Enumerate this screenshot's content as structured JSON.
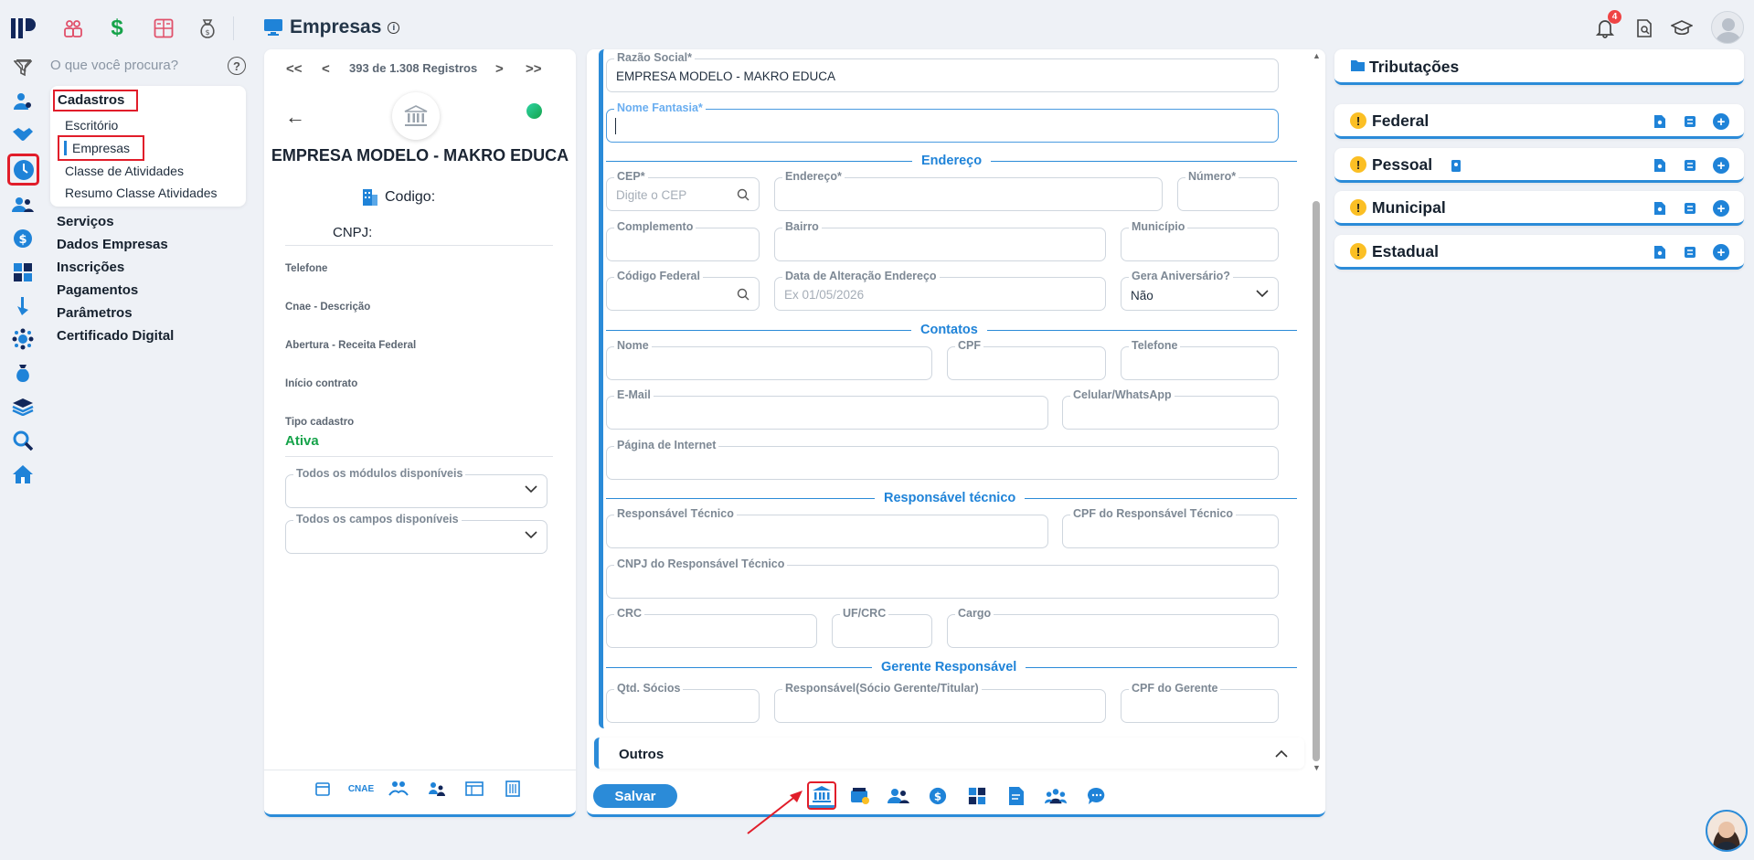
{
  "app": {
    "title": "Empresas"
  },
  "topbar": {
    "notification_count": "4"
  },
  "search": {
    "placeholder": "O que você procura?"
  },
  "submenu": {
    "heading": "Cadastros",
    "items": [
      "Escritório",
      "Empresas",
      "Classe de Atividades",
      "Resumo Classe Atividades"
    ]
  },
  "menu": [
    "Serviços",
    "Dados Empresas",
    "Inscrições",
    "Pagamentos",
    "Parâmetros",
    "Certificado Digital"
  ],
  "record_panel": {
    "pager": "393 de 1.308 Registros",
    "company_name": "EMPRESA MODELO - MAKRO EDUCA",
    "codigo_label": "Codigo:",
    "cnpj_label": "CNPJ:",
    "telefone_label": "Telefone",
    "cnae_label": "Cnae - Descrição",
    "abertura_label": "Abertura - Receita Federal",
    "inicio_label": "Início contrato",
    "tipo_label": "Tipo cadastro",
    "tipo_value": "Ativa",
    "modulos_label": "Todos os módulos disponíveis",
    "campos_label": "Todos os campos disponíveis",
    "cnae_tab": "CNAE"
  },
  "form": {
    "razao_social_label": "Razão Social*",
    "razao_social_value": "EMPRESA MODELO  - MAKRO EDUCA",
    "nome_fantasia_label": "Nome Fantasia*",
    "sections": {
      "endereco": "Endereço",
      "contatos": "Contatos",
      "responsavel_tecnico": "Responsável técnico",
      "gerente": "Gerente Responsável"
    },
    "cep_label": "CEP*",
    "cep_placeholder": "Digite o CEP",
    "endereco_label": "Endereço*",
    "numero_label": "Número*",
    "complemento_label": "Complemento",
    "bairro_label": "Bairro",
    "municipio_label": "Município",
    "codigo_federal_label": "Código Federal",
    "data_alteracao_label": "Data de Alteração Endereço",
    "data_alteracao_placeholder": "Ex 01/05/2026",
    "gera_aniversario_label": "Gera Aniversário?",
    "gera_aniversario_value": "Não",
    "nome_label": "Nome",
    "cpf_label": "CPF",
    "telefone_label": "Telefone",
    "email_label": "E-Mail",
    "celular_label": "Celular/WhatsApp",
    "pagina_label": "Página de Internet",
    "resp_tecnico_label": "Responsável Técnico",
    "cpf_resp_label": "CPF do Responsável Técnico",
    "cnpj_resp_label": "CNPJ do Responsável Técnico",
    "crc_label": "CRC",
    "uf_crc_label": "UF/CRC",
    "cargo_label": "Cargo",
    "qtd_socios_label": "Qtd. Sócios",
    "responsavel_socio_label": "Responsável(Sócio Gerente/Titular)",
    "cpf_gerente_label": "CPF do Gerente",
    "outros_label": "Outros",
    "salvar_label": "Salvar"
  },
  "tributacoes": {
    "title": "Tributações",
    "items": [
      "Federal",
      "Pessoal",
      "Municipal",
      "Estadual"
    ]
  },
  "colors": {
    "accent": "#1f83d8",
    "highlight": "#e11d2a",
    "active_status": "#22c55e"
  }
}
